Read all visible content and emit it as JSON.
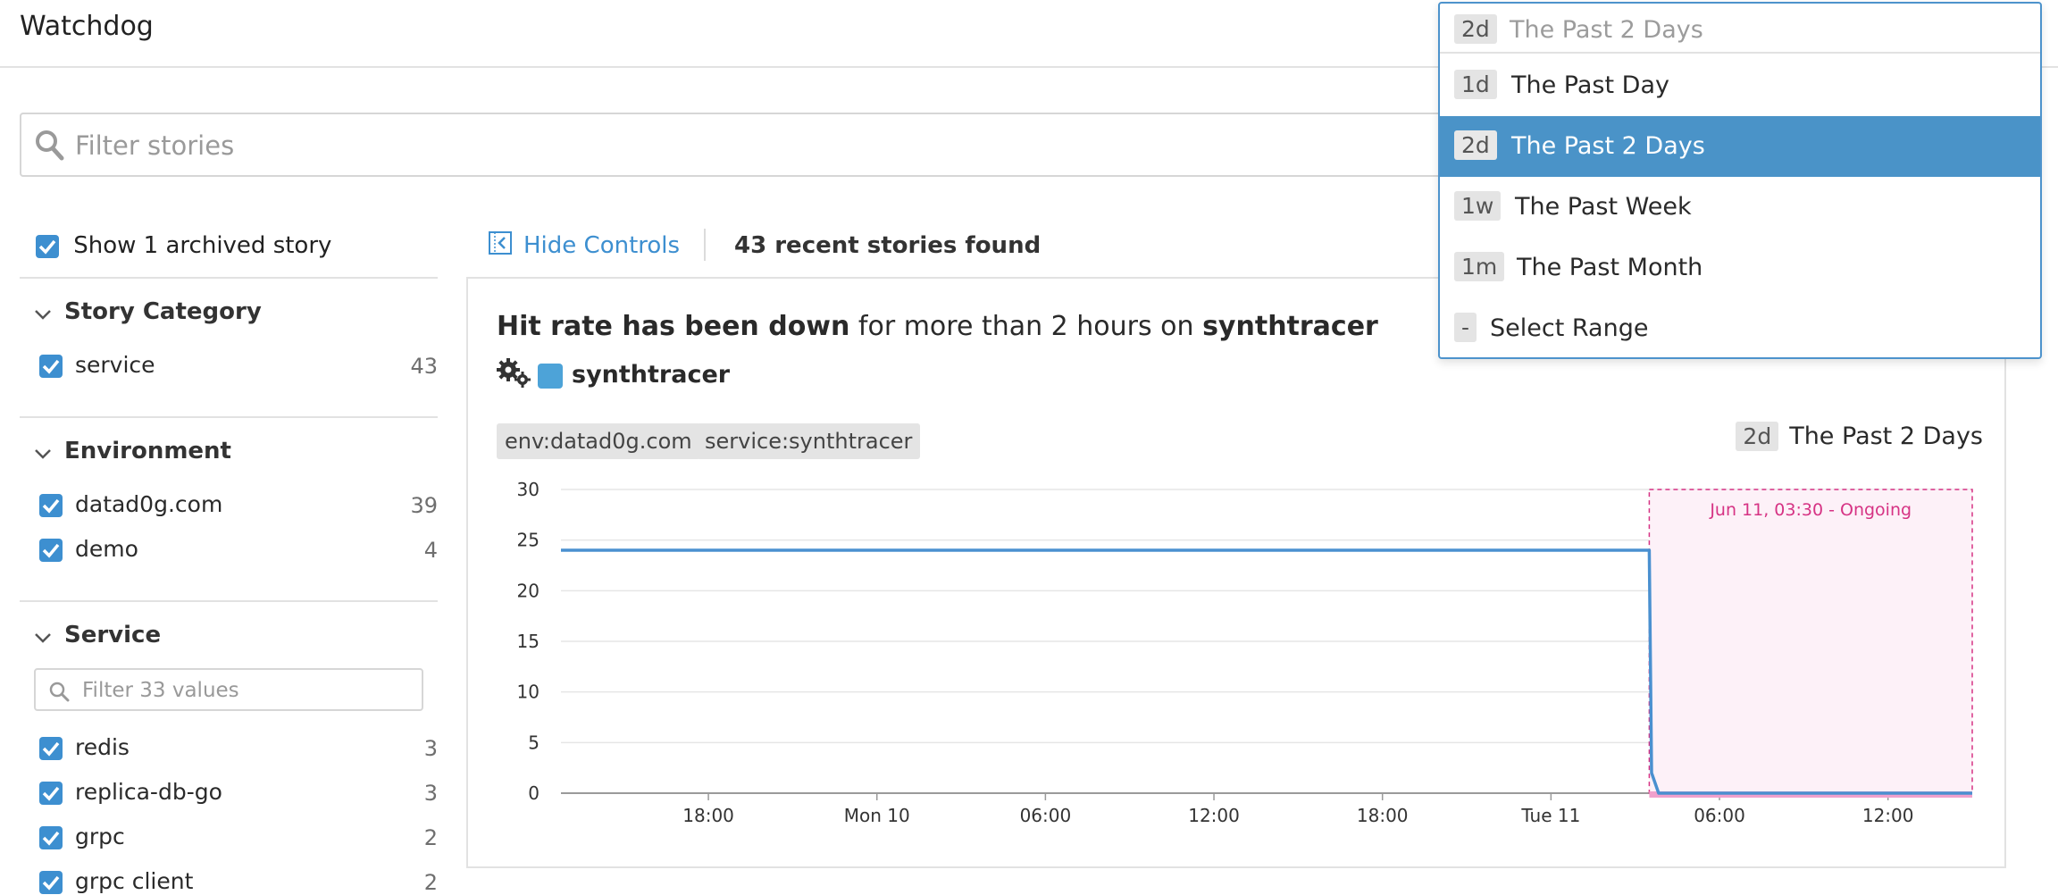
{
  "app": {
    "title": "Watchdog"
  },
  "search": {
    "placeholder": "Filter stories"
  },
  "sidebar": {
    "archived_label": "Show 1 archived story",
    "sections": [
      {
        "title": "Story Category",
        "items": [
          {
            "label": "service",
            "count": "43"
          }
        ]
      },
      {
        "title": "Environment",
        "items": [
          {
            "label": "datad0g.com",
            "count": "39"
          },
          {
            "label": "demo",
            "count": "4"
          }
        ]
      },
      {
        "title": "Service",
        "filter_placeholder": "Filter 33 values",
        "items": [
          {
            "label": "redis",
            "count": "3"
          },
          {
            "label": "replica-db-go",
            "count": "3"
          },
          {
            "label": "grpc",
            "count": "2"
          },
          {
            "label": "grpc client",
            "count": "2"
          }
        ]
      }
    ]
  },
  "controls": {
    "hide_controls": "Hide Controls",
    "found": "43 recent stories found"
  },
  "story": {
    "title_bold": "Hit rate has been down",
    "title_rest": " for more than 2 hours on ",
    "title_service": "synthtracer",
    "service_name": "synthtracer",
    "service_color": "#4da3d8",
    "tags": [
      "env:datad0g.com",
      "service:synthtracer"
    ],
    "range_abbr": "2d",
    "range_label": "The Past 2 Days"
  },
  "dropdown": {
    "current_abbr": "2d",
    "current_label": "The Past 2 Days",
    "options": [
      {
        "abbr": "1d",
        "label": "The Past Day",
        "selected": false
      },
      {
        "abbr": "2d",
        "label": "The Past 2 Days",
        "selected": true
      },
      {
        "abbr": "1w",
        "label": "The Past Week",
        "selected": false
      },
      {
        "abbr": "1m",
        "label": "The Past Month",
        "selected": false
      },
      {
        "abbr": "-",
        "label": "Select Range",
        "selected": false
      }
    ],
    "selected_color": "#4a93c8"
  },
  "chart_data": {
    "type": "line",
    "x_ticks": [
      "18:00",
      "Mon 10",
      "06:00",
      "12:00",
      "18:00",
      "Tue 11",
      "06:00",
      "12:00"
    ],
    "y_ticks": [
      0,
      5,
      10,
      15,
      20,
      25,
      30
    ],
    "ylim": [
      0,
      30
    ],
    "series": [
      {
        "points": [
          [
            "Jun 9 12:45",
            24
          ],
          [
            "Jun 11 03:30",
            24
          ],
          [
            "Jun 11 03:35",
            2
          ],
          [
            "Jun 11 03:50",
            0
          ],
          [
            "Jun 11 15:00",
            0
          ]
        ]
      }
    ],
    "annotation": {
      "label": "Jun 11, 03:30 - Ongoing",
      "start": "Jun 11 03:30",
      "color": "#d63384"
    },
    "grid": true,
    "line_color": "#4a90d0"
  }
}
